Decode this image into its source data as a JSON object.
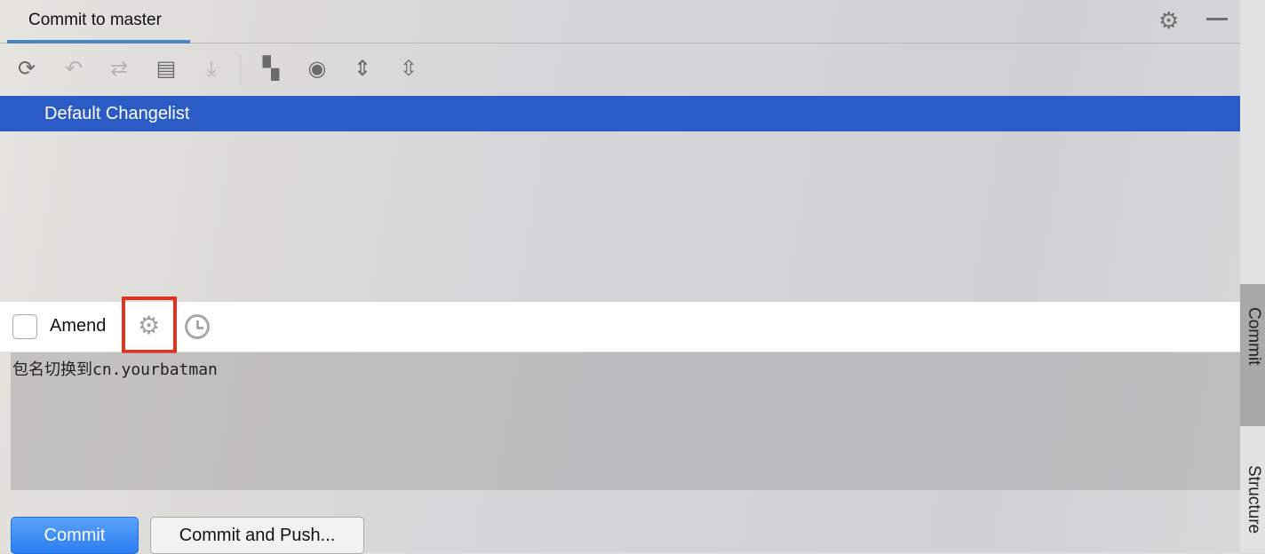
{
  "header": {
    "tab_title": "Commit to master",
    "icons": [
      "gear-icon",
      "minimize-icon"
    ]
  },
  "toolbar": {
    "icons": [
      "refresh-icon",
      "rollback-icon",
      "merge-icon",
      "show-diff-icon",
      "update-icon",
      "group-by-icon",
      "view-options-icon",
      "expand-all-icon",
      "collapse-all-icon"
    ]
  },
  "changelist": {
    "name": "Default Changelist"
  },
  "amend": {
    "label": "Amend",
    "checked": false,
    "icons": [
      "settings-gear-icon",
      "history-clock-icon"
    ]
  },
  "message": {
    "value": "包名切换到cn.yourbatman"
  },
  "buttons": {
    "commit": "Commit",
    "commit_push": "Commit and Push..."
  },
  "side_panel": {
    "commit": "Commit",
    "structure": "Structure"
  },
  "colors": {
    "accent": "#2b5cc5",
    "highlight": "#e2321f",
    "primary_button": "#2b7ef2"
  }
}
